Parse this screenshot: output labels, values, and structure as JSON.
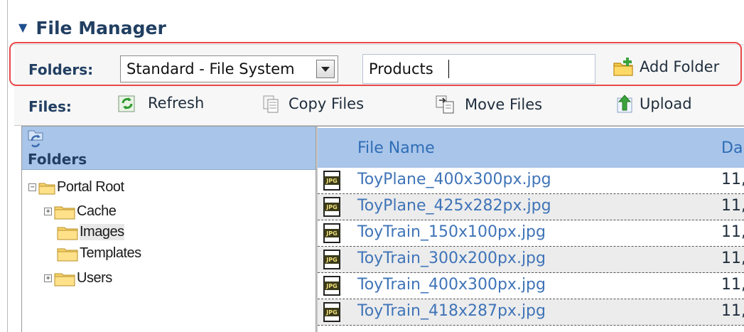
{
  "title": {
    "text": "File Manager",
    "collapse_glyph": "▼"
  },
  "folders_bar": {
    "label": "Folders:",
    "select_value": "Standard - File System",
    "folder_input_value": "Products",
    "add_folder_label": "Add Folder"
  },
  "files_bar": {
    "label": "Files:",
    "refresh_label": "Refresh",
    "copy_label": "Copy Files",
    "move_label": "Move Files",
    "upload_label": "Upload"
  },
  "tree": {
    "header": "Folders",
    "nodes": [
      {
        "label": "Portal Root",
        "expander": "−"
      },
      {
        "label": "Cache",
        "expander": "+"
      },
      {
        "label": "Images",
        "selected": true
      },
      {
        "label": "Templates"
      },
      {
        "label": "Users",
        "expander": "+"
      }
    ]
  },
  "file_list": {
    "columns": [
      "File Name",
      "Da"
    ],
    "rows": [
      {
        "name": "ToyPlane_400x300px.jpg",
        "date": "11,"
      },
      {
        "name": "ToyPlane_425x282px.jpg",
        "date": "11,"
      },
      {
        "name": "ToyTrain_150x100px.jpg",
        "date": "11,"
      },
      {
        "name": "ToyTrain_300x200px.jpg",
        "date": "11,"
      },
      {
        "name": "ToyTrain_400x300px.jpg",
        "date": "11,"
      },
      {
        "name": "ToyTrain_418x287px.jpg",
        "date": "11,"
      }
    ],
    "file_icon_text": "JPG"
  },
  "colors": {
    "highlight_outline": "#e8474b",
    "header_blue": "#a9c5ea",
    "link_blue": "#3f74b8",
    "title_navy": "#213f62"
  }
}
